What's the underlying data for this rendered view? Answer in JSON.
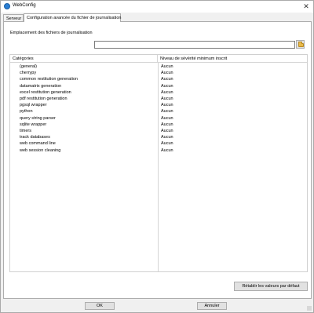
{
  "window": {
    "title": "WebConfig",
    "close_glyph": "✕"
  },
  "tabs": [
    {
      "label": "Serveur",
      "selected": false
    },
    {
      "label": "Configuration avancée du fichier de journalisation",
      "selected": true
    }
  ],
  "log_location": {
    "label": "Emplacement des fichiers de journalisation",
    "value": "",
    "browse_icon": "folder-icon"
  },
  "table": {
    "columns": [
      "Catégories",
      "Niveau de sévérité minimum inscrit"
    ],
    "rows": [
      {
        "category": "(general)",
        "level": "Aucun"
      },
      {
        "category": "cherrypy",
        "level": "Aucun"
      },
      {
        "category": "common restitution generation",
        "level": "Aucun"
      },
      {
        "category": "datamatrix generation",
        "level": "Aucun"
      },
      {
        "category": "excel restitution generation",
        "level": "Aucun"
      },
      {
        "category": "pdf restitution generation",
        "level": "Aucun"
      },
      {
        "category": "pgsql wrapper",
        "level": "Aucun"
      },
      {
        "category": "python",
        "level": "Aucun"
      },
      {
        "category": "query string parser",
        "level": "Aucun"
      },
      {
        "category": "sqlite wrapper",
        "level": "Aucun"
      },
      {
        "category": "timers",
        "level": "Aucun"
      },
      {
        "category": "track databases",
        "level": "Aucun"
      },
      {
        "category": "web command line",
        "level": "Aucun"
      },
      {
        "category": "web session cleaning",
        "level": "Aucun"
      }
    ]
  },
  "buttons": {
    "reset": "Rétablir les valeurs par défaut",
    "ok": "OK",
    "cancel": "Annuler"
  },
  "colors": {
    "app_icon": "#2b7fd4",
    "folder_icon": "#e8b94a"
  }
}
